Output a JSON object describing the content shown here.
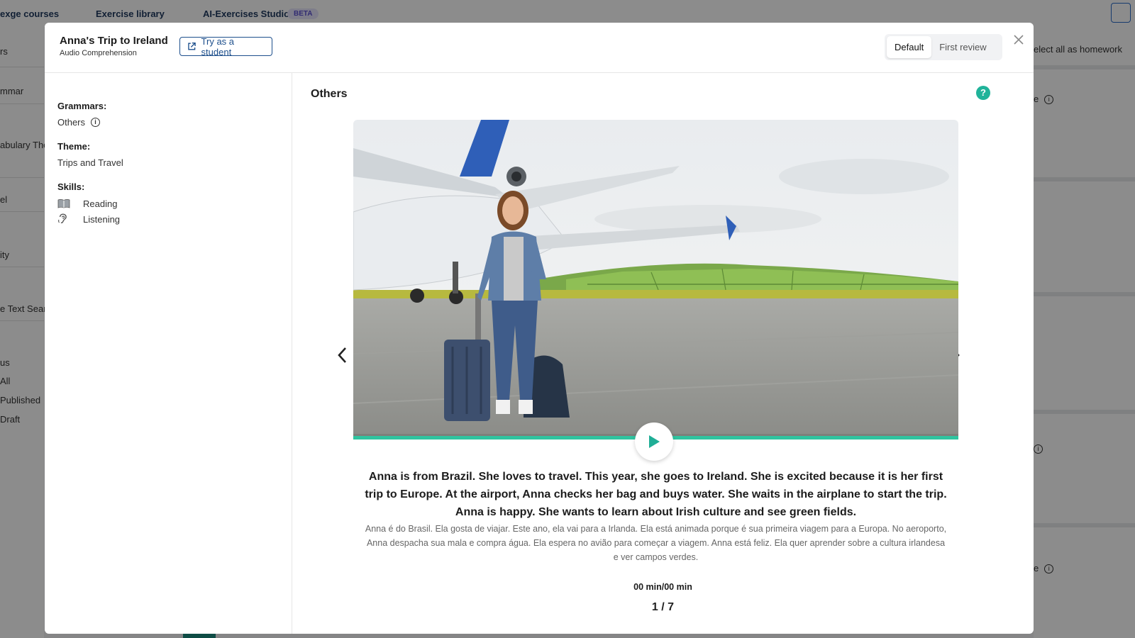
{
  "background": {
    "nav": [
      "exge courses",
      "Exercise library",
      "AI-Exercises Studio"
    ],
    "beta_badge": "BETA",
    "left_panel": [
      "rs",
      "mmar",
      "abulary The",
      "el",
      "ity",
      "e Text Searc",
      "us",
      "All",
      "Published",
      "Draft"
    ],
    "right_panel_select_all": "elect all as homework",
    "right_panel_e1": "e",
    "right_panel_e2": "e"
  },
  "modal": {
    "title": "Anna's Trip to Ireland",
    "subtitle": "Audio Comprehension",
    "try_button": "Try as a student",
    "modes": [
      "Default",
      "First review"
    ],
    "active_mode": "Default"
  },
  "sidebar": {
    "grammars_label": "Grammars:",
    "grammars_value": "Others",
    "theme_label": "Theme:",
    "theme_value": "Trips and Travel",
    "skills_label": "Skills:",
    "skills": [
      "Reading",
      "Listening"
    ]
  },
  "main": {
    "section_title": "Others",
    "help": "?",
    "english_text": "Anna is from Brazil. She loves to travel. This year, she goes to Ireland. She is excited because it is her first trip to Europe. At the airport, Anna checks her bag and buys water. She waits in the airplane to start the trip. Anna is happy. She wants to learn about Irish culture and see green fields.",
    "portuguese_text": "Anna é do Brasil. Ela gosta de viajar. Este ano, ela vai para a Irlanda. Ela está animada porque é sua primeira viagem para a Europa. No aeroporto, Anna despacha sua mala e compra água. Ela espera no avião para começar a viagem. Anna está feliz. Ela quer aprender sobre a cultura irlandesa e ver campos verdes.",
    "time": "00 min/00 min",
    "pager": "1 / 7",
    "audio_progress": 1.0
  },
  "colors": {
    "accent_teal": "#2fc4a0",
    "button_blue": "#1d4f8c",
    "help_green": "#20b39a"
  }
}
